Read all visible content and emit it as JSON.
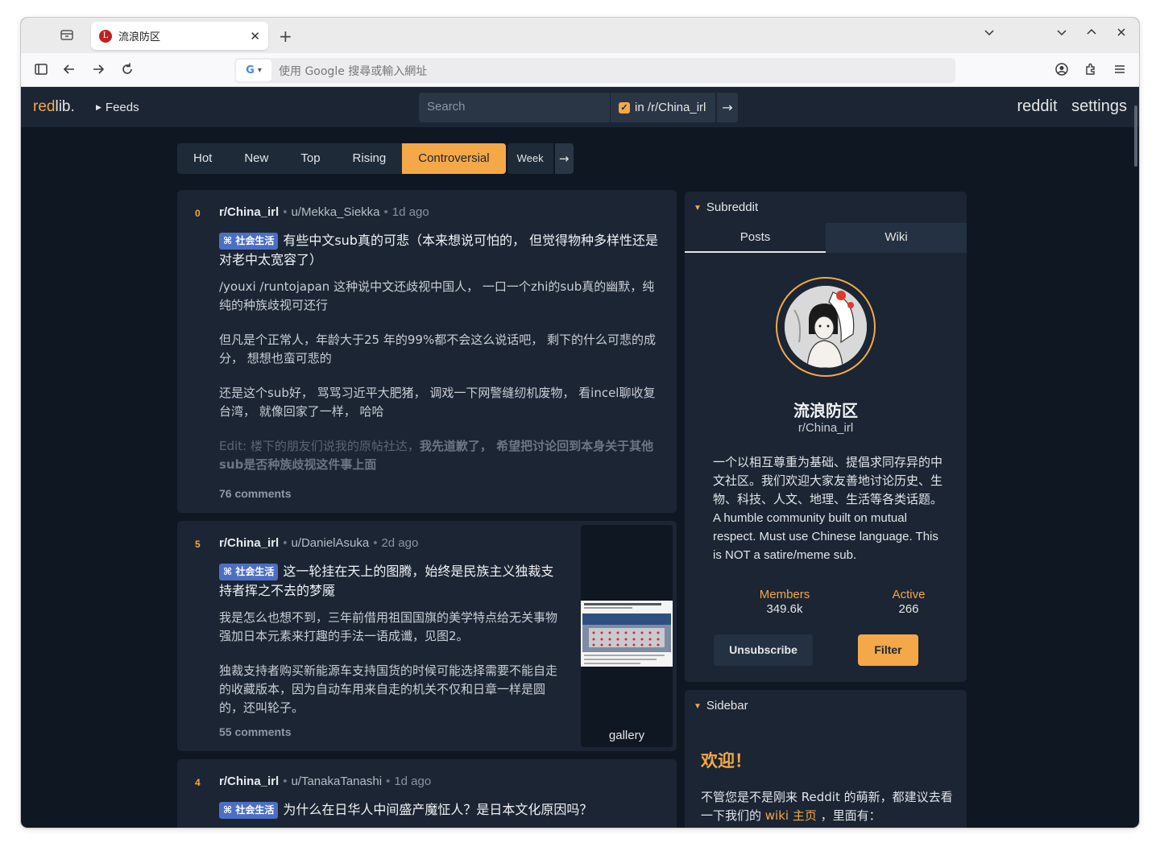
{
  "browser": {
    "tab_title": "流浪防区",
    "favicon_letter": "L",
    "url_placeholder": "使用 Google 搜尋或輸入網址",
    "engine_letter": "G"
  },
  "header": {
    "logo_main": "red",
    "logo_rest": "lib.",
    "feeds_label": "Feeds",
    "search_placeholder": "Search",
    "restrict_label": "in /r/China_irl",
    "reddit_link": "reddit",
    "settings_link": "settings"
  },
  "sort": {
    "items": [
      "Hot",
      "New",
      "Top",
      "Rising",
      "Controversial"
    ],
    "active": "Controversial",
    "time": "Week"
  },
  "posts": [
    {
      "score": "0",
      "subreddit": "r/China_irl",
      "author": "u/Mekka_Siekka",
      "ago": "1d ago",
      "flair": "社会生活",
      "title": "有些中文sub真的可悲（本来想说可怕的， 但觉得物种多样性还是对老中太宽容了）",
      "body": [
        "/youxi /runtojapan 这种说中文还歧视中国人， 一口一个zhi的sub真的幽默，纯纯的种族歧视可还行",
        "但凡是个正常人，年龄大于25 年的99%都不会这么说话吧， 剩下的什么可悲的成分， 想想也蛮可悲的",
        "还是这个sub好， 骂骂习近平大肥猪， 调戏一下网警缝纫机废物， 看incel聊收复台湾， 就像回家了一样， 哈哈"
      ],
      "edit_prefix": "Edit: 楼下的朋友们说我的原帖社达，",
      "edit_bold": "我先道歉了， 希望把讨论回到本身关于其他sub是否种族歧视这件事上面",
      "comments": "76 comments"
    },
    {
      "score": "5",
      "subreddit": "r/China_irl",
      "author": "u/DanielAsuka",
      "ago": "2d ago",
      "flair": "社会生活",
      "title": "这一轮挂在天上的图腾，始终是民族主义独裁支持者挥之不去的梦魇",
      "body": [
        "我是怎么也想不到，三年前借用祖国国旗的美学特点给无关事物强加日本元素来打趣的手法一语成谶，见图2。",
        "独裁支持者购买新能源车支持国货的时候可能选择需要不能自走的收藏版本，因为自动车用来自走的机关不仅和日章一样是圆的，还叫轮子。"
      ],
      "thumb_caption": "gallery",
      "comments": "55 comments"
    },
    {
      "score": "4",
      "subreddit": "r/China_irl",
      "author": "u/TanakaTanashi",
      "ago": "1d ago",
      "flair": "社会生活",
      "title": "为什么在日华人中间盛产魔怔人？是日本文化原因吗？"
    }
  ],
  "subreddit_panel": {
    "heading": "Subreddit",
    "tabs": [
      "Posts",
      "Wiki"
    ],
    "name": "流浪防区",
    "tag": "r/China_irl",
    "description_zh": "一个以相互尊重为基础、提倡求同存异的中文社区。我们欢迎大家友善地讨论历史、生物、科技、人文、地理、生活等各类话题。",
    "description_en": " A humble community built on mutual respect. Must use Chinese language. This is NOT a satire/meme sub.",
    "members_label": "Members",
    "members_value": "349.6k",
    "active_label": "Active",
    "active_value": "266",
    "unsubscribe_label": "Unsubscribe",
    "filter_label": "Filter"
  },
  "sidebar_panel": {
    "heading": "Sidebar",
    "welcome": "欢迎！",
    "text_before": "不管您是不是刚来 Reddit 的萌新，都建议去看一下我们的 ",
    "link": "wiki 主页",
    "text_after": " ，里面有："
  },
  "colors": {
    "accent": "#f5a847",
    "background": "#0f1722",
    "panel": "#1b2533",
    "flair": "#4b6fc4"
  }
}
